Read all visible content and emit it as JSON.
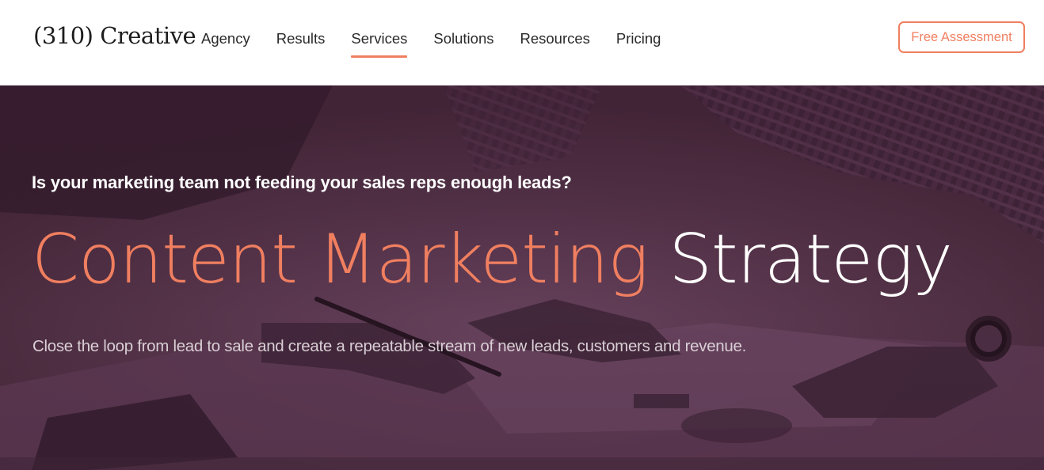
{
  "header": {
    "logo_text": "(310) Creative",
    "nav": [
      {
        "label": "Agency",
        "active": false
      },
      {
        "label": "Results",
        "active": false
      },
      {
        "label": "Services",
        "active": true
      },
      {
        "label": "Solutions",
        "active": false
      },
      {
        "label": "Resources",
        "active": false
      },
      {
        "label": "Pricing",
        "active": false
      }
    ],
    "cta_label": "Free Assessment"
  },
  "hero": {
    "eyebrow": "Is your marketing team not feeding your sales reps enough leads?",
    "headline_accent": "Content Marketing",
    "headline_rest": "Strategy",
    "subhead": "Close the loop from lead to sale and create a repeatable stream of new leads, customers and revenue."
  },
  "colors": {
    "accent": "#f07f60",
    "hero_tint": "#4f2e45",
    "text_dark": "#2b2b2b",
    "white": "#ffffff"
  },
  "icons": {
    "background_image": "team-meeting-photo"
  }
}
